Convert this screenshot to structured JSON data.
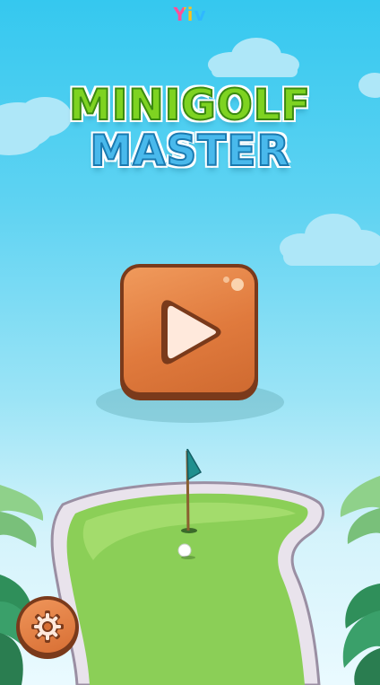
{
  "brand": {
    "logo_text": "Yiv"
  },
  "title": {
    "line1": "MINIGOLF",
    "line2": "MASTER"
  },
  "buttons": {
    "play_icon": "play-icon",
    "settings_icon": "gear-icon"
  },
  "colors": {
    "sky_top": "#35c8ef",
    "title_green": "#7ed321",
    "title_blue": "#3fb6ea",
    "button_orange": "#e07a3d",
    "button_outline": "#7a3a1b",
    "grass": "#86c94a",
    "flag": "#1f8f8f"
  }
}
